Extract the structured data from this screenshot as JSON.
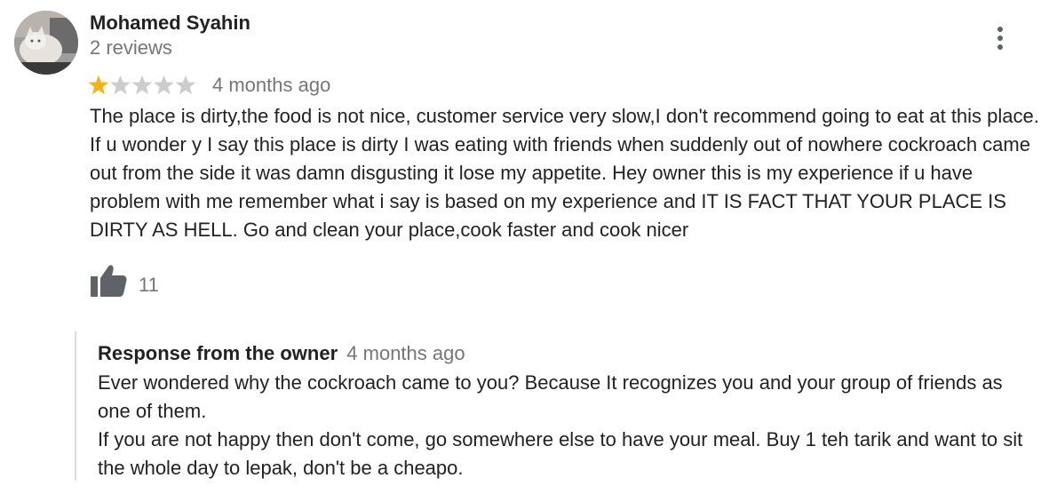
{
  "review": {
    "author_name": "Mohamed Syahin",
    "review_count": "2 reviews",
    "rating": 1,
    "max_rating": 5,
    "date": "4 months ago",
    "text": "The place is dirty,the food is not nice, customer service very slow,I don't recommend going to eat at this place. If u wonder y I say this place is dirty I was eating with friends when suddenly out of nowhere cockroach came out from the side it was damn disgusting it lose my appetite. Hey owner this is my experience if u have problem with me remember what i say is based on my experience and IT IS FACT THAT YOUR PLACE IS DIRTY AS HELL. Go and clean your place,cook faster and cook nicer",
    "like_count": "11",
    "icons": {
      "avatar": "avatar-cat-photo",
      "more": "more-vert-icon",
      "like": "thumbs-up-icon",
      "star": "star-icon"
    },
    "colors": {
      "star_filled": "#f3b41b",
      "star_empty": "#cccccc",
      "secondary_text": "#767676",
      "icon": "#5f6368"
    }
  },
  "owner_response": {
    "label": "Response from the owner",
    "date": "4 months ago",
    "paragraph_1": "Ever wondered why the cockroach came to you? Because It recognizes you and your group of friends as one of them.",
    "paragraph_2": "If you are not happy then don't come, go somewhere else to have your meal. Buy 1 teh tarik and want to sit the whole day to lepak, don't be a cheapo."
  }
}
